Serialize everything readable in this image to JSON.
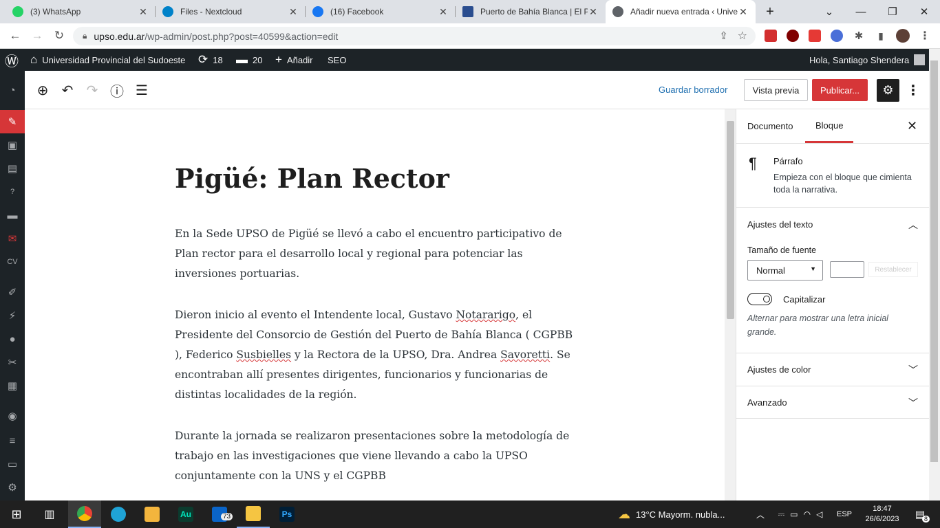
{
  "browser": {
    "tabs": [
      {
        "title": "(3) WhatsApp",
        "icon": "whatsapp-icon",
        "color": "#25d366"
      },
      {
        "title": "Files - Nextcloud",
        "icon": "nextcloud-icon",
        "color": "#0082c9"
      },
      {
        "title": "(16) Facebook",
        "icon": "facebook-icon",
        "color": "#1877f2"
      },
      {
        "title": "Puerto de Bahía Blanca | El Pu",
        "icon": "puerto-icon",
        "color": "#2a4d8f"
      },
      {
        "title": "Añadir nueva entrada ‹ Unive",
        "icon": "wordpress-globe-icon",
        "color": "#5f6368"
      }
    ],
    "url_domain": "upso.edu.ar",
    "url_path": "/wp-admin/post.php?post=40599&action=edit"
  },
  "adminbar": {
    "site_name": "Universidad Provincial del Sudoeste",
    "updates_count": "18",
    "comments_count": "20",
    "add_label": "Añadir",
    "seo_label": "SEO",
    "greeting": "Hola, Santiago Shendera"
  },
  "editor": {
    "save_draft": "Guardar borrador",
    "preview": "Vista previa",
    "publish": "Publicar...",
    "title": "Pigüé: Plan Rector",
    "p1": "En la Sede UPSO de Pigüé se llevó a cabo el encuentro participativo de Plan rector para el desarrollo local y regional para potenciar las inversiones portuarias.",
    "p2_a": "Dieron inicio al evento el Intendente local, Gustavo ",
    "p2_b": "Notararigo",
    "p2_c": ", el Presidente del Consorcio de Gestión del Puerto de Bahía Blanca ( CGPBB  ), Federico ",
    "p2_d": "Susbielles",
    "p2_e": " y la Rectora de la UPSO, Dra. Andrea ",
    "p2_f": "Savoretti",
    "p2_g": ". Se encontraban allí presentes dirigentes, funcionarios y funcionarias de distintas localidades de la región.",
    "p3": "Durante la jornada se realizaron presentaciones sobre la metodología de trabajo en las investigaciones que viene llevando a cabo la UPSO conjuntamente con la UNS y el CGPBB"
  },
  "sidebar": {
    "tab_document": "Documento",
    "tab_block": "Bloque",
    "block_name": "Párrafo",
    "block_desc": "Empieza con el bloque que cimienta toda la narrativa.",
    "text_settings": "Ajustes del texto",
    "font_size_label": "Tamaño de fuente",
    "font_size_value": "Normal",
    "reset_label": "Restablecer",
    "dropcap_label": "Capitalizar",
    "dropcap_help": "Alternar para mostrar una letra inicial grande.",
    "color_settings": "Ajustes de color",
    "advanced": "Avanzado"
  },
  "taskbar": {
    "mail_badge": "73",
    "weather": "13°C  Mayorm. nubla...",
    "lang": "ESP",
    "time": "18:47",
    "date": "26/6/2023",
    "notif_count": "8"
  }
}
